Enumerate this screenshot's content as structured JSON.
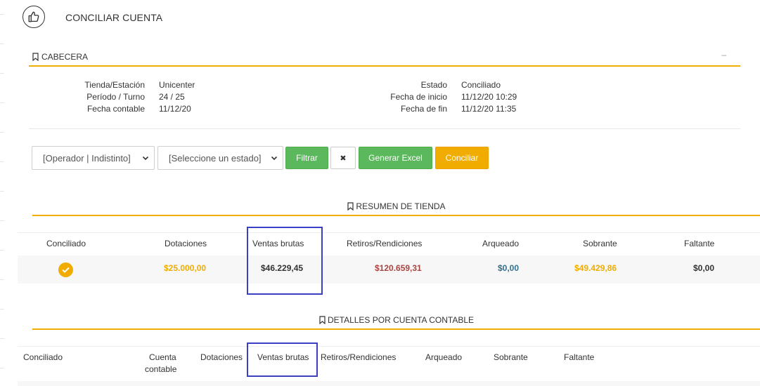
{
  "page": {
    "title": "CONCILIAR CUENTA",
    "title_icon": "thumbs-up-icon"
  },
  "cabecera": {
    "label": "CABECERA",
    "minimize": "–",
    "left": [
      {
        "key": "Tienda/Estación",
        "value": "Unicenter"
      },
      {
        "key": "Período / Turno",
        "value": "24 / 25"
      },
      {
        "key": "Fecha contable",
        "value": "11/12/20"
      }
    ],
    "right": [
      {
        "key": "Estado",
        "value": "Conciliado"
      },
      {
        "key": "Fecha de inicio",
        "value": "11/12/20 10:29"
      },
      {
        "key": "Fecha de fin",
        "value": "11/12/20 11:35"
      }
    ]
  },
  "filters": {
    "operator_select": "[Operador | Indistinto]",
    "state_select": "[Seleccione un estado]",
    "filter_button": "Filtrar",
    "clear_button": "✖",
    "excel_button": "Generar Excel",
    "reconcile_button": "Conciliar"
  },
  "resumen": {
    "label": "RESUMEN DE TIENDA",
    "headers": [
      "Conciliado",
      "Dotaciones",
      "Ventas brutas",
      "Retiros/Rendiciones",
      "Arqueado",
      "Sobrante",
      "Faltante"
    ],
    "values": {
      "dotaciones": "$25.000,00",
      "ventas_brutas": "$46.229,45",
      "retiros": "$120.659,31",
      "arqueado": "$0,00",
      "sobrante": "$49.429,86",
      "faltante": "$0,00"
    }
  },
  "detalles": {
    "label": "DETALLES POR CUENTA CONTABLE",
    "headers": {
      "conciliado": "Conciliado",
      "cuenta_1": "Cuenta",
      "cuenta_2": "contable",
      "dotaciones": "Dotaciones",
      "ventas_brutas": "Ventas brutas",
      "retiros": "Retiros/Rendiciones",
      "arqueado": "Arqueado",
      "sobrante": "Sobrante",
      "faltante": "Faltante"
    }
  },
  "colors": {
    "accent": "#f0ad00",
    "green": "#5cb85c",
    "red_value": "#a94442",
    "blue_value": "#31708f",
    "highlight": "#3b3fc4"
  }
}
